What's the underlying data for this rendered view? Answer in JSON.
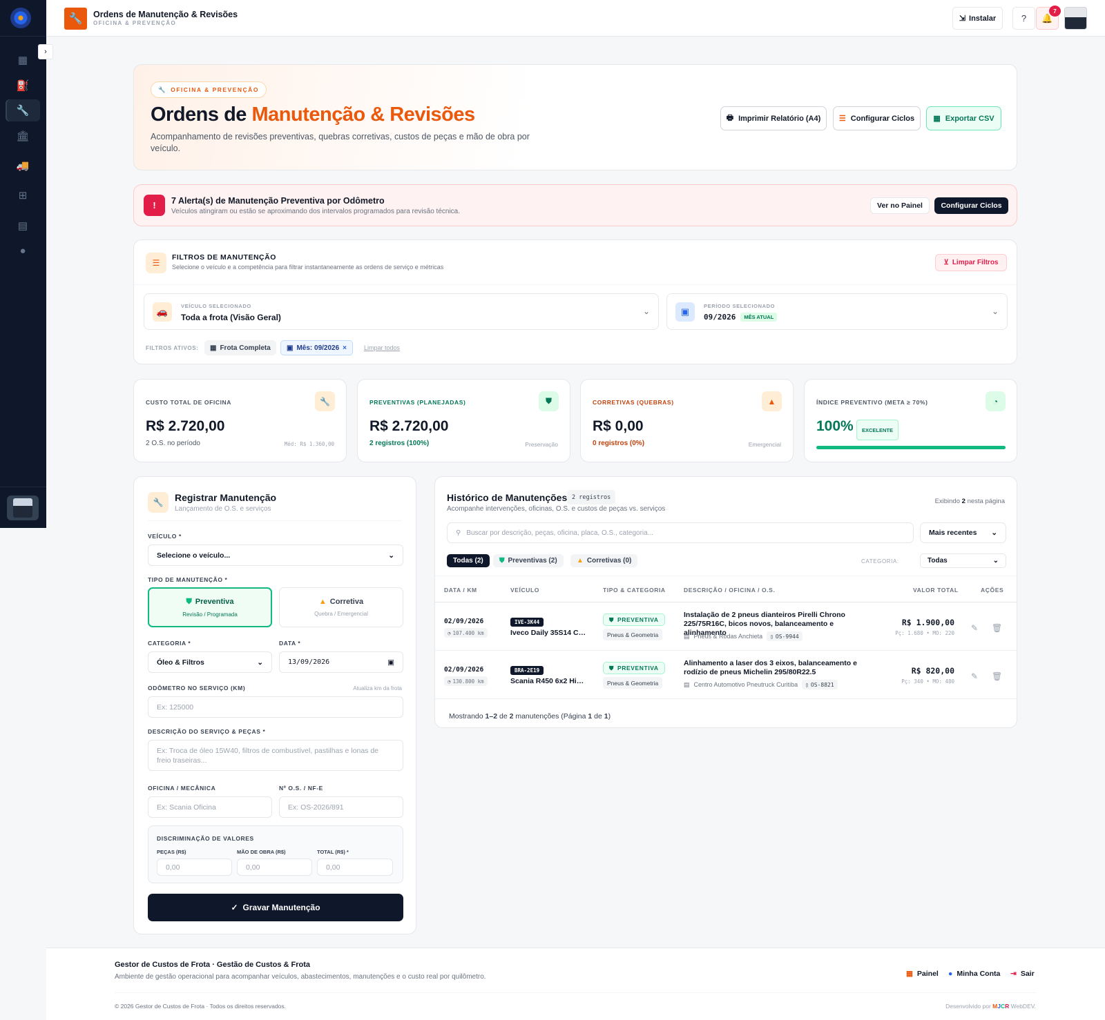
{
  "header": {
    "title": "Ordens de Manutenção & Revisões",
    "subtitle": "OFICINA & PREVENÇÃO",
    "install_label": "Instalar",
    "notification_count": "7"
  },
  "hero": {
    "pill": "OFICINA & PREVENÇÃO",
    "title_prefix": "Ordens de ",
    "title_accent": "Manutenção & Revisões",
    "description": "Acompanhamento de revisões preventivas, quebras corretivas, custos de peças e mão de obra por veículo.",
    "btn_print": "Imprimir Relatório (A4)",
    "btn_cycles": "Configurar Ciclos",
    "btn_export": "Exportar CSV"
  },
  "alert": {
    "title": "7 Alerta(s) de Manutenção Preventiva por Odômetro",
    "description": "Veículos atingiram ou estão se aproximando dos intervalos programados para revisão técnica.",
    "btn_panel": "Ver no Painel",
    "btn_config": "Configurar Ciclos"
  },
  "filters": {
    "title": "FILTROS DE MANUTENÇÃO",
    "description": "Selecione o veículo e a competência para filtrar instantaneamente as ordens de serviço e métricas",
    "clear_label": "Limpar Filtros",
    "vehicle_label": "VEÍCULO SELECIONADO",
    "vehicle_value": "Toda a frota (Visão Geral)",
    "period_label": "PERÍODO SELECIONADO",
    "period_value": "09/2026",
    "period_badge": "MÊS ATUAL",
    "active_label": "FILTROS ATIVOS:",
    "chip_fleet": "Frota Completa",
    "chip_month": "Mês: 09/2026",
    "clear_all": "Limpar todos"
  },
  "kpis": [
    {
      "label": "CUSTO TOTAL DE OFICINA",
      "value": "R$ 2.720,00",
      "sub": "2 O.S. no período",
      "note": "Méd: R$ 1.360,00"
    },
    {
      "label": "PREVENTIVAS (PLANEJADAS)",
      "value": "R$ 2.720,00",
      "sub": "2 registros (100%)",
      "note": "Preservação"
    },
    {
      "label": "CORRETIVAS (QUEBRAS)",
      "value": "R$ 0,00",
      "sub": "0 registros (0%)",
      "note": "Emergencial"
    },
    {
      "label": "ÍNDICE PREVENTIVO (META ≥ 70%)",
      "value": "100%",
      "badge": "EXCELENTE",
      "progress": 1.0
    }
  ],
  "form": {
    "title": "Registrar Manutenção",
    "description": "Lançamento de O.S. e serviços",
    "vehicle_label": "VEÍCULO *",
    "vehicle_value": "Selecione o veículo...",
    "type_label": "TIPO DE MANUTENÇÃO *",
    "prev_title": "Preventiva",
    "prev_sub": "Revisão / Programada",
    "corr_title": "Corretiva",
    "corr_sub": "Quebra / Emergencial",
    "category_label": "CATEGORIA *",
    "category_value": "Óleo & Filtros",
    "date_label": "DATA *",
    "date_value": "13/09/2026",
    "odometer_label": "ODÔMETRO NO SERVIÇO (KM)",
    "odometer_hint": "Atualiza km da frota",
    "odometer_placeholder": "Ex: 125000",
    "desc_label": "DESCRIÇÃO DO SERVIÇO & PEÇAS *",
    "desc_placeholder": "Ex: Troca de óleo 15W40, filtros de combustível, pastilhas e lonas de freio traseiras...",
    "shop_label": "OFICINA / MECÂNICA",
    "shop_placeholder": "Ex: Scania Oficina",
    "os_label": "Nº O.S. / NF-E",
    "os_placeholder": "Ex: OS-2026/891",
    "values_title": "DISCRIMINAÇÃO DE VALORES",
    "parts_label": "PEÇAS (R$)",
    "labor_label": "MÃO DE OBRA (R$)",
    "total_label": "TOTAL (R$) *",
    "amount_placeholder": "0,00",
    "save_label": "Gravar Manutenção"
  },
  "history": {
    "title": "Histórico de Manutenções",
    "count": "2 registros",
    "description": "Acompanhe intervenções, oficinas, O.S. e custos de peças vs. serviços",
    "showing_prefix": "Exibindo ",
    "showing_num": "2",
    "showing_suffix": " nesta página",
    "search_placeholder": "Buscar por descrição, peças, oficina, placa, O.S., categoria...",
    "sort_value": "Mais recentes",
    "tab_all": "Todas (2)",
    "tab_prev": "Preventivas (2)",
    "tab_corr": "Corretivas (0)",
    "category_label": "CATEGORIA:",
    "category_value": "Todas",
    "columns": [
      "DATA / KM",
      "VEÍCULO",
      "TIPO & CATEGORIA",
      "DESCRIÇÃO / OFICINA / O.S.",
      "VALOR TOTAL",
      "AÇÕES"
    ],
    "rows": [
      {
        "date": "02/09/2026",
        "km": "107.400 km",
        "plate": "IVE-3K44",
        "vehicle": "Iveco Daily 35S14 Ch...",
        "type": "PREVENTIVA",
        "category": "Pneus & Geometria",
        "desc": "Instalação de 2 pneus dianteiros Pirelli Chrono 225/75R16C, bicos novos, balanceamento e alinhamento",
        "shop": "Pneus & Rodas Anchieta",
        "os": "OS-9944",
        "value": "R$ 1.900,00",
        "breakdown": "Pç: 1.680 • MO: 220"
      },
      {
        "date": "02/09/2026",
        "km": "130.800 km",
        "plate": "BRA-2E19",
        "vehicle": "Scania R450 6x2 Hig...",
        "type": "PREVENTIVA",
        "category": "Pneus & Geometria",
        "desc": "Alinhamento a laser dos 3 eixos, balanceamento e rodízio de pneus Michelin 295/80R22.5",
        "shop": "Centro Automotivo Pneutruck Curitiba",
        "os": "OS-8821",
        "value": "R$ 820,00",
        "breakdown": "Pç: 340 • MO: 480"
      }
    ],
    "foot_1": "Mostrando ",
    "foot_range": "1–2",
    "foot_2": " de ",
    "foot_total": "2",
    "foot_3": " manutenções (Página ",
    "foot_page": "1",
    "foot_4": " de ",
    "foot_pages": "1",
    "foot_5": ")"
  },
  "footer": {
    "title": "Gestor de Custos de Frota · Gestão de Custos & Frota",
    "description": "Ambiente de gestão operacional para acompanhar veículos, abastecimentos, manutenções e o custo real por quilômetro.",
    "copyright": "© 2026 Gestor de Custos de Frota · Todos os direitos reservados.",
    "dev_prefix": "Desenvolvido por ",
    "dev_m": "M",
    "dev_j": "J",
    "dev_c": "C",
    "dev_r": "R",
    "dev_suffix": " WebDEV.",
    "link_panel": "Painel",
    "link_account": "Minha Conta",
    "link_logout": "Sair"
  },
  "colors": {
    "accent": "#ea580c",
    "success": "#047857",
    "danger": "#e11d48",
    "dark": "#0f172a"
  }
}
